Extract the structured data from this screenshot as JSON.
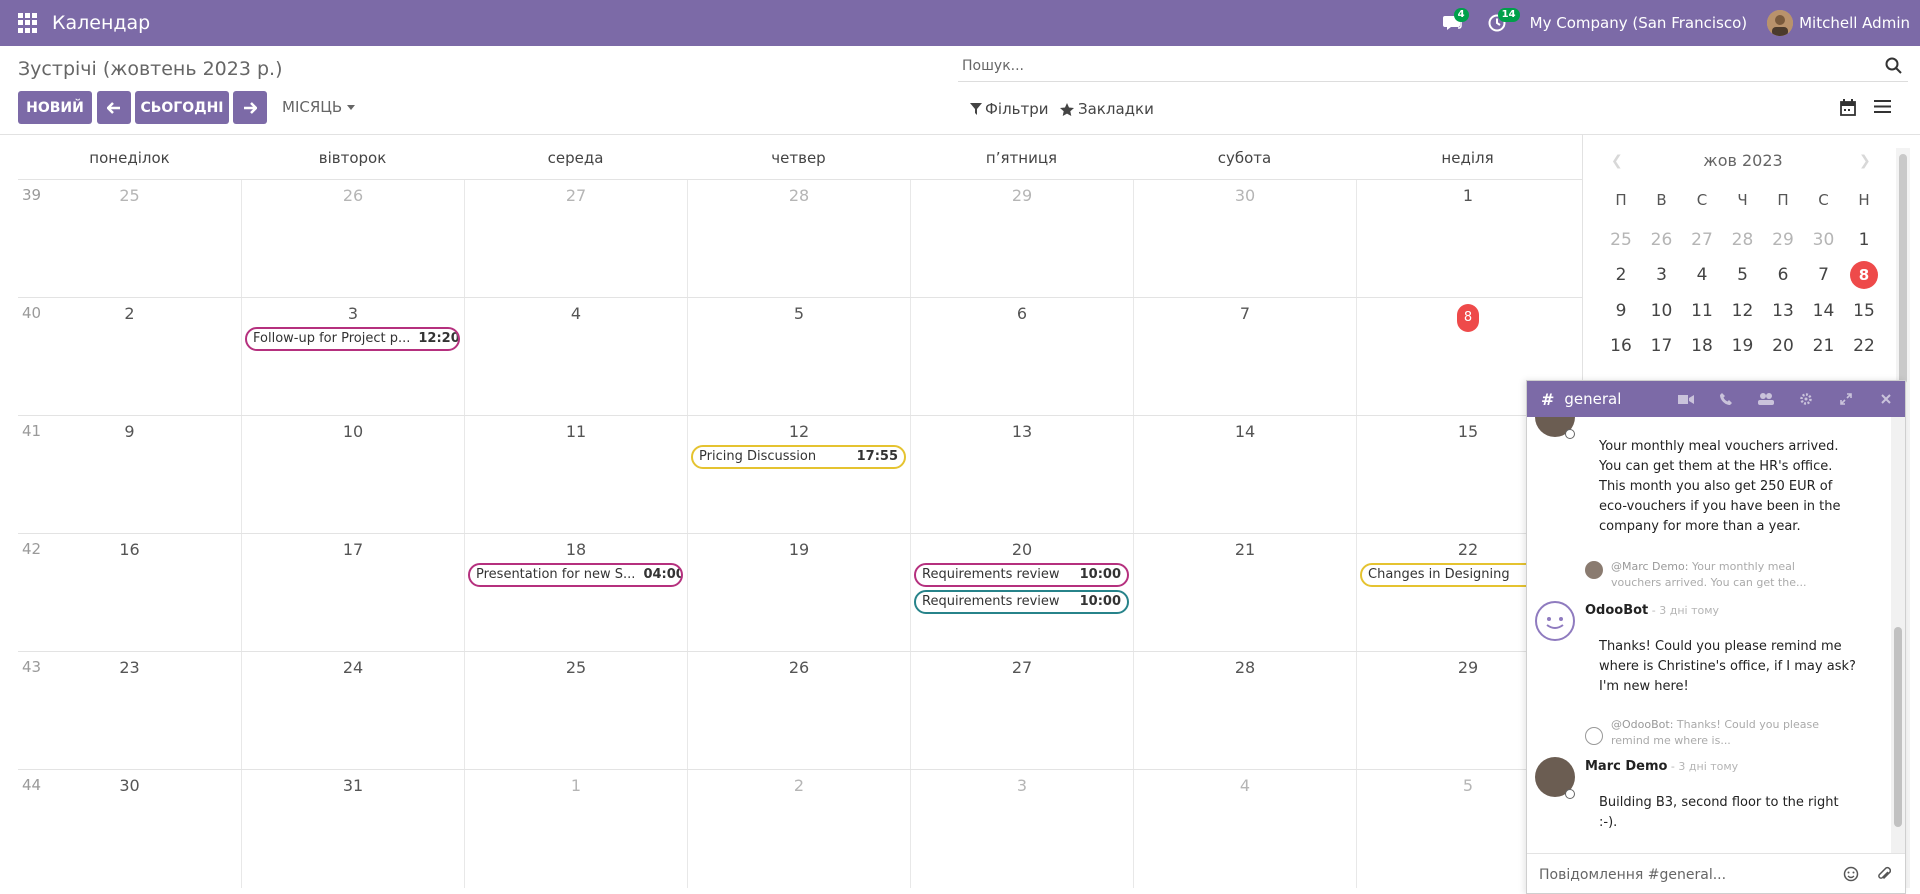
{
  "navbar": {
    "app_title": "Календар",
    "messages_badge": "4",
    "activities_badge": "14",
    "company": "My Company (San Francisco)",
    "user": "Mitchell Admin"
  },
  "control_panel": {
    "title": "Зустрічі (жовтень 2023 р.)",
    "new_label": "НОВИЙ",
    "today_label": "СЬОГОДНІ",
    "scale_label": "МІСЯЦЬ",
    "search_placeholder": "Пошук...",
    "filters_label": "Фільтри",
    "bookmarks_label": "Закладки"
  },
  "calendar": {
    "weekdays": [
      "понеділок",
      "вівторок",
      "середа",
      "четвер",
      "п’ятниця",
      "субота",
      "неділя"
    ],
    "weeks": [
      {
        "num": "39",
        "days": [
          {
            "d": "25",
            "other": true
          },
          {
            "d": "26",
            "other": true
          },
          {
            "d": "27",
            "other": true
          },
          {
            "d": "28",
            "other": true
          },
          {
            "d": "29",
            "other": true
          },
          {
            "d": "30",
            "other": true
          },
          {
            "d": "1",
            "other": false
          }
        ]
      },
      {
        "num": "40",
        "days": [
          {
            "d": "2"
          },
          {
            "d": "3"
          },
          {
            "d": "4"
          },
          {
            "d": "5"
          },
          {
            "d": "6"
          },
          {
            "d": "7"
          },
          {
            "d": "8",
            "today": true
          }
        ]
      },
      {
        "num": "41",
        "days": [
          {
            "d": "9"
          },
          {
            "d": "10"
          },
          {
            "d": "11"
          },
          {
            "d": "12"
          },
          {
            "d": "13"
          },
          {
            "d": "14"
          },
          {
            "d": "15"
          }
        ]
      },
      {
        "num": "42",
        "days": [
          {
            "d": "16"
          },
          {
            "d": "17"
          },
          {
            "d": "18"
          },
          {
            "d": "19"
          },
          {
            "d": "20"
          },
          {
            "d": "21"
          },
          {
            "d": "22"
          }
        ]
      },
      {
        "num": "43",
        "days": [
          {
            "d": "23"
          },
          {
            "d": "24"
          },
          {
            "d": "25"
          },
          {
            "d": "26"
          },
          {
            "d": "27"
          },
          {
            "d": "28"
          },
          {
            "d": "29"
          }
        ]
      },
      {
        "num": "44",
        "days": [
          {
            "d": "30"
          },
          {
            "d": "31"
          },
          {
            "d": "1",
            "other": true
          },
          {
            "d": "2",
            "other": true
          },
          {
            "d": "3",
            "other": true
          },
          {
            "d": "4",
            "other": true
          },
          {
            "d": "5",
            "other": true
          }
        ]
      }
    ],
    "events": [
      {
        "title": "Follow-up for Project p...",
        "time": "12:20",
        "week": 1,
        "day": 1,
        "slot": 0,
        "color": "#b5307e"
      },
      {
        "title": "Pricing Discussion",
        "time": "17:55",
        "week": 2,
        "day": 3,
        "slot": 0,
        "color": "#e5c330"
      },
      {
        "title": "Presentation for new S...",
        "time": "04:00",
        "week": 3,
        "day": 2,
        "slot": 0,
        "color": "#b5307e"
      },
      {
        "title": "Requirements review",
        "time": "10:00",
        "week": 3,
        "day": 4,
        "slot": 0,
        "color": "#b5307e"
      },
      {
        "title": "Requirements review",
        "time": "10:00",
        "week": 3,
        "day": 4,
        "slot": 1,
        "color": "#27838a"
      },
      {
        "title": "Changes in Designing",
        "time": "",
        "week": 3,
        "day": 6,
        "slot": 0,
        "color": "#e5c330"
      }
    ]
  },
  "mini_calendar": {
    "title": "жов 2023",
    "dow": [
      "П",
      "В",
      "С",
      "Ч",
      "П",
      "С",
      "Н"
    ],
    "rows": [
      [
        {
          "d": "25",
          "other": true
        },
        {
          "d": "26",
          "other": true
        },
        {
          "d": "27",
          "other": true
        },
        {
          "d": "28",
          "other": true
        },
        {
          "d": "29",
          "other": true
        },
        {
          "d": "30",
          "other": true
        },
        {
          "d": "1"
        }
      ],
      [
        {
          "d": "2"
        },
        {
          "d": "3"
        },
        {
          "d": "4"
        },
        {
          "d": "5"
        },
        {
          "d": "6"
        },
        {
          "d": "7"
        },
        {
          "d": "8",
          "today": true
        }
      ],
      [
        {
          "d": "9"
        },
        {
          "d": "10"
        },
        {
          "d": "11"
        },
        {
          "d": "12"
        },
        {
          "d": "13"
        },
        {
          "d": "14"
        },
        {
          "d": "15"
        }
      ],
      [
        {
          "d": "16"
        },
        {
          "d": "17"
        },
        {
          "d": "18"
        },
        {
          "d": "19"
        },
        {
          "d": "20"
        },
        {
          "d": "21"
        },
        {
          "d": "22"
        }
      ]
    ]
  },
  "chat": {
    "hash": "#",
    "channel": "general",
    "messages": {
      "first_text_1": "Your monthly meal vouchers arrived. You can get them at the HR's office.",
      "first_text_2": "This month you also get 250 EUR of eco-vouchers if you have been in the company for more than a year.",
      "reply1_author": "@Marc Demo:",
      "reply1_text": "Your monthly meal vouchers arrived. You can get the...",
      "bot_author": "OdooBot",
      "bot_when": " - 3 дні тому",
      "bot_text": "Thanks! Could you please remind me where is Christine's office, if I may ask? I'm new here!",
      "reply2_author": "@OdooBot:",
      "reply2_text": "Thanks! Could you please remind me where is...",
      "marc_author": "Marc Demo",
      "marc_when": " - 3 дні тому",
      "marc_text": "Building B3, second floor to the right :-)."
    },
    "composer_placeholder": "Повідомлення #general..."
  }
}
